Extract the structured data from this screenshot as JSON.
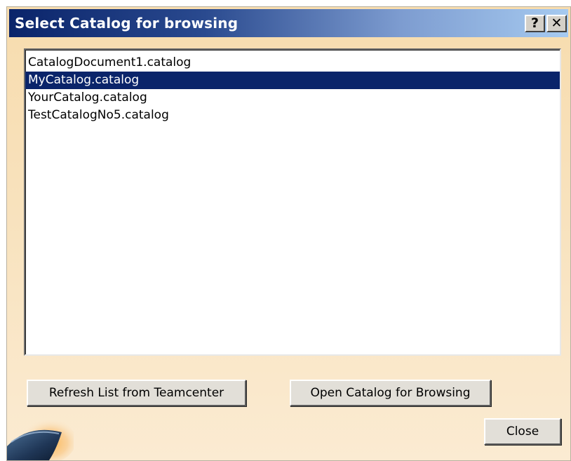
{
  "dialog": {
    "title": "Select Catalog for browsing",
    "help_glyph": "?",
    "close_glyph": "✕"
  },
  "catalog_list": {
    "items": [
      "CatalogDocument1.catalog",
      "MyCatalog.catalog",
      "YourCatalog.catalog",
      "TestCatalogNo5.catalog"
    ],
    "selected_item": "MyCatalog.catalog"
  },
  "buttons": {
    "refresh_label": "Refresh List from Teamcenter",
    "open_label": "Open Catalog for Browsing",
    "close_label": "Close"
  },
  "colors": {
    "titlebar_start": "#0a246a",
    "titlebar_end": "#a6caf0",
    "selection": "#0a246a",
    "dialog_background": "#f8e2bd"
  },
  "icons": {
    "help": "help-icon",
    "close": "close-icon",
    "brand": "catia-logo"
  }
}
